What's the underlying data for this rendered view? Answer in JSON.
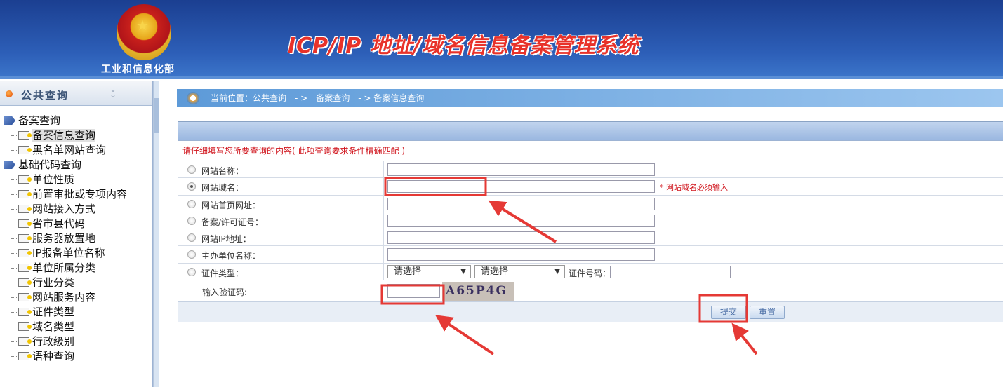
{
  "header": {
    "ministry": "工业和信息化部",
    "title": "ICP/IP 地址/域名信息备案管理系统"
  },
  "sidebar": {
    "title": "公共查询",
    "items": [
      {
        "label": "备案查询",
        "level": 0
      },
      {
        "label": "备案信息查询",
        "level": 1,
        "selected": true
      },
      {
        "label": "黑名单网站查询",
        "level": 1
      },
      {
        "label": "基础代码查询",
        "level": 0
      },
      {
        "label": "单位性质",
        "level": 1
      },
      {
        "label": "前置审批或专项内容",
        "level": 1
      },
      {
        "label": "网站接入方式",
        "level": 1
      },
      {
        "label": "省市县代码",
        "level": 1
      },
      {
        "label": "服务器放置地",
        "level": 1
      },
      {
        "label": "IP报备单位名称",
        "level": 1
      },
      {
        "label": "单位所属分类",
        "level": 1
      },
      {
        "label": "行业分类",
        "level": 1
      },
      {
        "label": "网站服务内容",
        "level": 1
      },
      {
        "label": "证件类型",
        "level": 1
      },
      {
        "label": "域名类型",
        "level": 1
      },
      {
        "label": "行政级别",
        "level": 1
      },
      {
        "label": "语种查询",
        "level": 1
      }
    ]
  },
  "breadcrumb": "当前位置：公共查询　- >　备案查询　- > 备案信息查询",
  "form": {
    "notice": "请仔细填写您所要查询的内容( 此项查询要求条件精确匹配 )",
    "fields": [
      {
        "label": "网站名称：",
        "value": ""
      },
      {
        "label": "网站域名：",
        "value": "",
        "selected": true,
        "required_note": "* 网站域名必须输入"
      },
      {
        "label": "网站首页网址：",
        "value": ""
      },
      {
        "label": "备案/许可证号：",
        "value": ""
      },
      {
        "label": "网站IP地址：",
        "value": ""
      },
      {
        "label": "主办单位名称：",
        "value": ""
      }
    ],
    "cert_type_label": "证件类型：",
    "cert_select1": "请选择",
    "cert_select2": "请选择",
    "cert_no_label": "证件号码：",
    "captcha_label": "输入验证码:",
    "captcha_text": "A65P4G",
    "submit": "提交",
    "reset": "重置"
  },
  "colors": {
    "annotation": "#e53935",
    "header": "#2d5fb8"
  }
}
